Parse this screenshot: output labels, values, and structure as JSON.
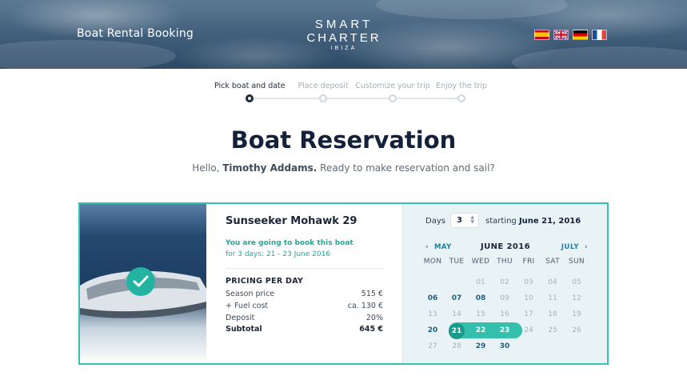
{
  "header": {
    "app_title": "Boat Rental Booking",
    "logo": {
      "line1": "SMART",
      "line2": "CHARTER",
      "line3": "IBIZA"
    },
    "flags": [
      {
        "code": "es",
        "icon": "spain-flag-icon"
      },
      {
        "code": "uk",
        "icon": "uk-flag-icon"
      },
      {
        "code": "de",
        "icon": "germany-flag-icon"
      },
      {
        "code": "fr",
        "icon": "france-flag-icon"
      }
    ]
  },
  "stepper": {
    "steps": [
      {
        "label": "Pick boat and date",
        "state": "active"
      },
      {
        "label": "Place deposit",
        "state": "upcoming"
      },
      {
        "label": "Customize your trip",
        "state": "upcoming"
      },
      {
        "label": "Enjoy the trip",
        "state": "upcoming"
      }
    ]
  },
  "page": {
    "title": "Boat Reservation",
    "greeting_prefix": "Hello, ",
    "user_name": "Timothy Addams.",
    "greeting_suffix": " Ready to make reservation and sail?"
  },
  "booking": {
    "boat_name": "Sunseeker Mohawk 29",
    "book_notice": "You are going to book this boat",
    "days_notice": "for 3 days: 21 - 23 June 2016",
    "pricing_title": "PRICING PER DAY",
    "prices": [
      {
        "label": "Season price",
        "value": "515 €"
      },
      {
        "label": "+ Fuel cost",
        "value": "ca. 130 €"
      },
      {
        "label": "Deposit",
        "value": "20%"
      }
    ],
    "subtotal": {
      "label": "Subtotal",
      "value": "645 €"
    }
  },
  "calendar": {
    "days_label": "Days",
    "days_value": "3",
    "starting_prefix": "starting ",
    "starting_date": "June 21, 2016",
    "prev_month": "MAY",
    "month_title": "JUNE 2016",
    "next_month": "JULY",
    "weekdays": [
      "MON",
      "TUE",
      "WED",
      "THU",
      "FRI",
      "SAT",
      "SUN"
    ],
    "weeks": [
      [
        null,
        null,
        "01",
        "02",
        "03",
        "04",
        "05"
      ],
      [
        "06",
        "07",
        "08",
        "09",
        "10",
        "11",
        "12"
      ],
      [
        "13",
        "14",
        "15",
        "16",
        "17",
        "18",
        "19"
      ],
      [
        "20",
        "21",
        "22",
        "23",
        "24",
        "25",
        "26"
      ],
      [
        "27",
        "28",
        "29",
        "30",
        null,
        null,
        null
      ]
    ],
    "available": [
      "06",
      "07",
      "08",
      "20",
      "29",
      "30"
    ],
    "selected": [
      "21",
      "22",
      "23"
    ],
    "accent_color": "#35c0ae"
  }
}
